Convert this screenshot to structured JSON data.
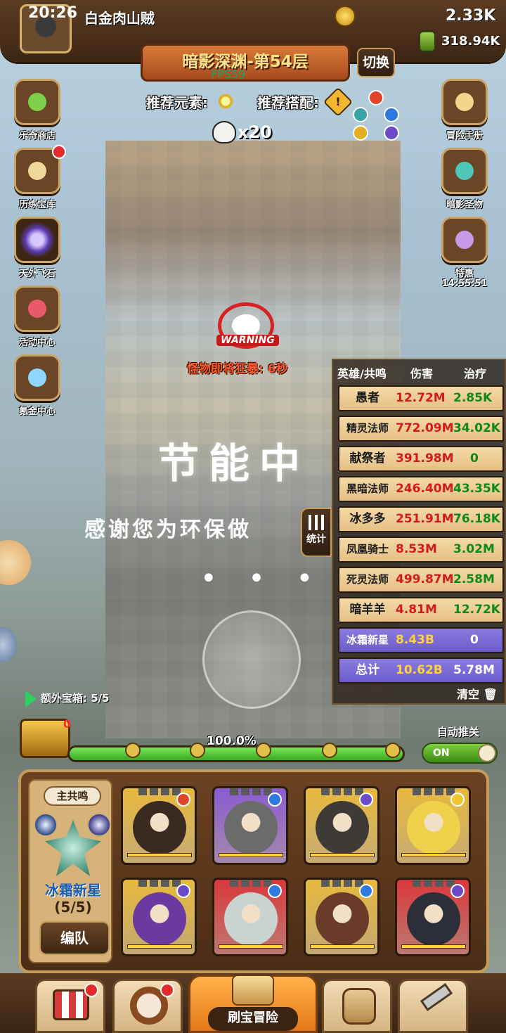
{
  "status": {
    "time": "20:26"
  },
  "player": {
    "name": "白金肉山贼"
  },
  "currency": {
    "gold": "2.33K",
    "potion": "318.94K"
  },
  "stage": {
    "title": "暗影深渊-第54层",
    "switch_label": "切换",
    "fps": "FPS59"
  },
  "recommend": {
    "element_label": "推荐元素:",
    "combo_label": "推荐搭配:",
    "combo_icon": "!"
  },
  "enemy": {
    "count": "x20"
  },
  "left_menu": [
    {
      "label": "乐奇商店",
      "icon": "clover-icon",
      "dot": false
    },
    {
      "label": "历练宝库",
      "icon": "scroll-icon",
      "dot": true
    },
    {
      "label": "天外飞石",
      "icon": "portal-icon",
      "dot": false
    },
    {
      "label": "活动中心",
      "icon": "gift-icon",
      "dot": false
    },
    {
      "label": "氪金中心",
      "icon": "diamond-icon",
      "dot": false
    }
  ],
  "right_menu": [
    {
      "label": "冒险手册",
      "icon": "map-scroll-icon"
    },
    {
      "label": "暗影圣物",
      "icon": "chest-icon"
    },
    {
      "label": "特惠",
      "sub": "14:55:51",
      "icon": "treasure-box-icon"
    }
  ],
  "warning": {
    "badge": "WARNING",
    "text": "怪物即将狂暴: 6秒"
  },
  "eco": {
    "title": "节能中",
    "thanks": "感谢您为环保做",
    "dots": "• • • •"
  },
  "stats_button": {
    "label": "统计"
  },
  "stats": {
    "headers": [
      "英雄/共鸣",
      "伤害",
      "治疗"
    ],
    "rows": [
      {
        "name": "愚者",
        "damage": "12.72M",
        "heal": "2.85K"
      },
      {
        "name": "精灵法师",
        "damage": "772.09M",
        "heal": "34.02K"
      },
      {
        "name": "献祭者",
        "damage": "391.98M",
        "heal": "0"
      },
      {
        "name": "黑暗法师",
        "damage": "246.40M",
        "heal": "43.35K"
      },
      {
        "name": "冰多多",
        "damage": "251.91M",
        "heal": "76.18K"
      },
      {
        "name": "凤凰骑士",
        "damage": "8.53M",
        "heal": "3.02M"
      },
      {
        "name": "死灵法师",
        "damage": "499.87M",
        "heal": "2.58M"
      },
      {
        "name": "暗羊羊",
        "damage": "4.81M",
        "heal": "12.72K"
      },
      {
        "name": "冰霜新星",
        "damage": "8.43B",
        "heal": "0"
      },
      {
        "name": "总计",
        "damage": "10.62B",
        "heal": "5.78M"
      }
    ],
    "clear_label": "清空"
  },
  "extra_chest": {
    "label": "额外宝箱: 5/5"
  },
  "chest": {
    "count": "0"
  },
  "progress": {
    "label": "100.0%",
    "value": 1.0
  },
  "auto": {
    "label": "自动推关",
    "toggle": "ON"
  },
  "team": {
    "main_resonance_label": "主共鸣",
    "resonance_name": "冰霜新星",
    "resonance_count": "(5/5)",
    "formation_label": "编队",
    "heroes": [
      {
        "bg": "#e7b93c",
        "portrait": "#3a2a22",
        "element": "#e0452a"
      },
      {
        "bg": "#8a5bd1",
        "portrait": "#6b6b6b",
        "element": "#2f7ae0"
      },
      {
        "bg": "#e7b93c",
        "portrait": "#3e3b36",
        "element": "#6b4bc7"
      },
      {
        "bg": "#e7b93c",
        "portrait": "#f0d24a",
        "element": "#f0c530"
      },
      {
        "bg": "#e7b93c",
        "portrait": "#6a3aa0",
        "element": "#6b4bc7"
      },
      {
        "bg": "#d9383a",
        "portrait": "#c9d3cf",
        "element": "#2f7ae0"
      },
      {
        "bg": "#e7b93c",
        "portrait": "#6b3b2a",
        "element": "#2f7ae0"
      },
      {
        "bg": "#d9383a",
        "portrait": "#2c2f3a",
        "element": "#6b4bc7"
      }
    ]
  },
  "bottom_nav": [
    {
      "name": "shop",
      "icon": "shop-icon",
      "dot": true
    },
    {
      "name": "hero",
      "icon": "hero-icon",
      "dot": true
    },
    {
      "name": "adventure",
      "label": "刷宝冒险",
      "icon": "map-compass-icon"
    },
    {
      "name": "bag",
      "icon": "backpack-icon"
    },
    {
      "name": "forge",
      "icon": "hammer-icon"
    }
  ]
}
